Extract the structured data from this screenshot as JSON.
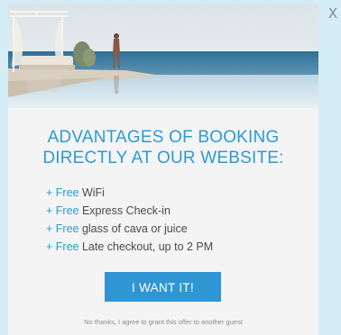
{
  "popup": {
    "close_label": "X",
    "headline_line1": "ADVANTAGES OF BOOKING",
    "headline_line2": "DIRECTLY AT OUR WEBSITE:",
    "benefits": [
      {
        "prefix": "+ Free ",
        "text": "WiFi"
      },
      {
        "prefix": "+ Free ",
        "text": "Express Check-in"
      },
      {
        "prefix": "+ Free ",
        "text": "glass of cava or juice"
      },
      {
        "prefix": "+ Free ",
        "text": "Late checkout, up to 2 PM"
      }
    ],
    "cta_label": "I WANT IT!",
    "decline_label": "No thanks, I agree to grant this offer to another guest"
  },
  "colors": {
    "accent": "#2b9bd4",
    "button": "#2f96d3",
    "card_bg": "#f4f4f4",
    "page_bg": "#d4edf6"
  }
}
